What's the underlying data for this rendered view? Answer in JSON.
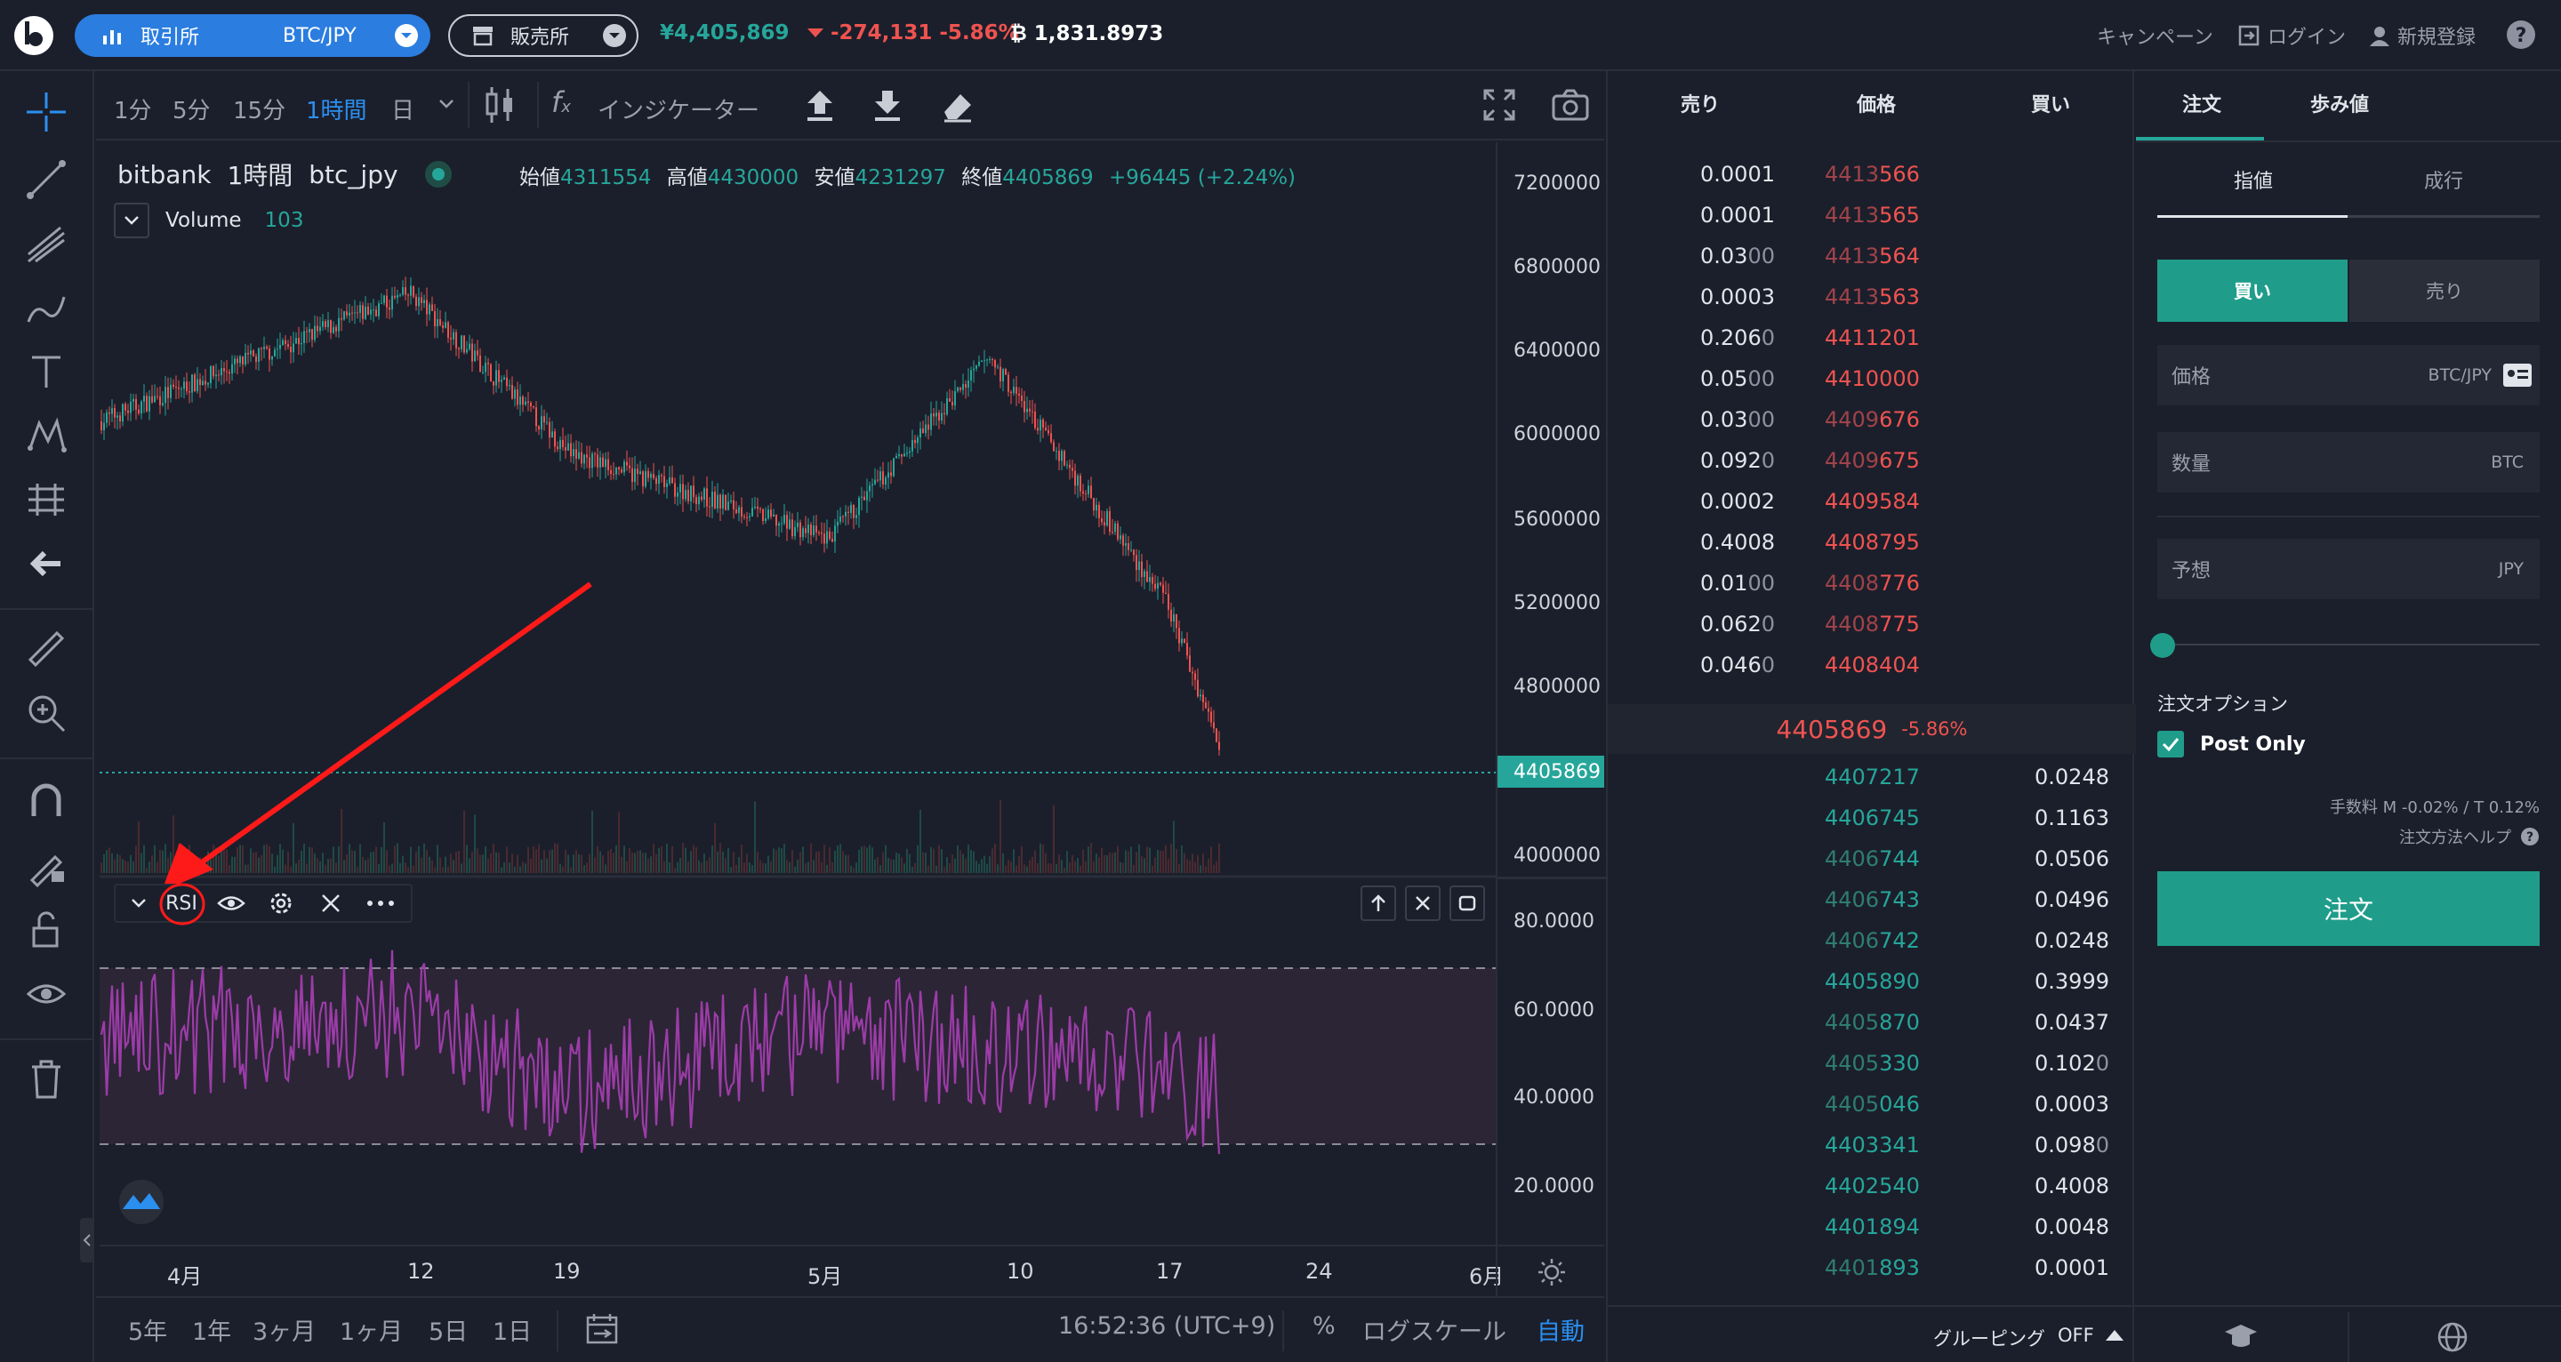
{
  "header": {
    "exchange_label": "取引所",
    "pair_label": "BTC/JPY",
    "store_label": "販売所",
    "price_jpy": "¥4,405,869",
    "change": "-274,131",
    "change_pct": "-5.86%",
    "btc_value": "1,831.8973",
    "campaign": "キャンペーン",
    "login": "ログイン",
    "signup": "新規登録"
  },
  "chart_toolbar": {
    "timeframes": [
      "1分",
      "5分",
      "15分",
      "1時間",
      "日"
    ],
    "active_timeframe": "1時間",
    "indicators": "インジケーター"
  },
  "legend": {
    "source": "bitbank",
    "interval": "1時間",
    "symbol": "btc_jpy",
    "open_label": "始値",
    "open": "4311554",
    "high_label": "高値",
    "high": "4430000",
    "low_label": "安値",
    "low": "4231297",
    "close_label": "終値",
    "close": "4405869",
    "change": "+96445 (+2.24%)",
    "volume_label": "Volume",
    "volume": "103"
  },
  "rsi_toolbar": {
    "label": "RSI"
  },
  "price_axis": {
    "labels": [
      "7200000",
      "6800000",
      "6400000",
      "6000000",
      "5600000",
      "5200000",
      "4800000",
      "4000000"
    ],
    "current": "4405869",
    "rsi_labels": [
      "80.0000",
      "60.0000",
      "40.0000",
      "20.0000"
    ]
  },
  "time_axis": {
    "labels": [
      "4月",
      "12",
      "19",
      "5月",
      "10",
      "17",
      "24",
      "6月"
    ]
  },
  "chart_bottom": {
    "ranges": [
      "5年",
      "1年",
      "3ヶ月",
      "1ヶ月",
      "5日",
      "1日"
    ],
    "clock": "16:52:36 (UTC+9)",
    "percent": "%",
    "log_scale": "ログスケール",
    "auto": "自動"
  },
  "chart_data": {
    "type": "line",
    "series": [
      {
        "x": [
          "4月",
          "12",
          "19",
          "5月",
          "10",
          "17",
          "24"
        ],
        "y": [
          6050000,
          6650000,
          5900000,
          5500000,
          6350000,
          5200000,
          4405869
        ]
      },
      {
        "x": [
          "4月",
          "12",
          "19",
          "5月",
          "10",
          "17",
          "24"
        ],
        "y": [
          55,
          62,
          40,
          58,
          52,
          45,
          38
        ]
      }
    ],
    "ylim": [
      4000000,
      7200000
    ],
    "rsi_ylim": [
      10,
      90
    ]
  },
  "orderbook": {
    "headers": {
      "sell": "売り",
      "price": "価格",
      "buy": "買い"
    },
    "asks": [
      {
        "qty": "0.0001",
        "qty_dim": "",
        "px_dim": "4413",
        "px": "566"
      },
      {
        "qty": "0.0001",
        "qty_dim": "",
        "px_dim": "4413",
        "px": "565"
      },
      {
        "qty": "0.03",
        "qty_dim": "00",
        "px_dim": "4413",
        "px": "564"
      },
      {
        "qty": "0.0003",
        "qty_dim": "",
        "px_dim": "4413",
        "px": "563"
      },
      {
        "qty": "0.206",
        "qty_dim": "0",
        "px_dim": "",
        "px": "4411201"
      },
      {
        "qty": "0.05",
        "qty_dim": "00",
        "px_dim": "",
        "px": "4410000"
      },
      {
        "qty": "0.03",
        "qty_dim": "00",
        "px_dim": "4409",
        "px": "676"
      },
      {
        "qty": "0.092",
        "qty_dim": "0",
        "px_dim": "4409",
        "px": "675"
      },
      {
        "qty": "0.0002",
        "qty_dim": "",
        "px_dim": "",
        "px": "4409584"
      },
      {
        "qty": "0.4008",
        "qty_dim": "",
        "px_dim": "",
        "px": "4408795"
      },
      {
        "qty": "0.01",
        "qty_dim": "00",
        "px_dim": "4408",
        "px": "776"
      },
      {
        "qty": "0.062",
        "qty_dim": "0",
        "px_dim": "4408",
        "px": "775"
      },
      {
        "qty": "0.046",
        "qty_dim": "0",
        "px_dim": "",
        "px": "4408404"
      }
    ],
    "mid_price": "4405869",
    "mid_change": "-5.86%",
    "bids": [
      {
        "px_dim": "",
        "px": "4407217",
        "qty": "0.0248",
        "qty_dim": ""
      },
      {
        "px_dim": "",
        "px": "4406745",
        "qty": "0.1163",
        "qty_dim": ""
      },
      {
        "px_dim": "4406",
        "px": "744",
        "qty": "0.0506",
        "qty_dim": ""
      },
      {
        "px_dim": "4406",
        "px": "743",
        "qty": "0.0496",
        "qty_dim": ""
      },
      {
        "px_dim": "4406",
        "px": "742",
        "qty": "0.0248",
        "qty_dim": ""
      },
      {
        "px_dim": "",
        "px": "4405890",
        "qty": "0.3999",
        "qty_dim": ""
      },
      {
        "px_dim": "4405",
        "px": "870",
        "qty": "0.0437",
        "qty_dim": ""
      },
      {
        "px_dim": "4405",
        "px": "330",
        "qty": "0.102",
        "qty_dim": "0"
      },
      {
        "px_dim": "4405",
        "px": "046",
        "qty": "0.0003",
        "qty_dim": ""
      },
      {
        "px_dim": "",
        "px": "4403341",
        "qty": "0.098",
        "qty_dim": "0"
      },
      {
        "px_dim": "",
        "px": "4402540",
        "qty": "0.4008",
        "qty_dim": ""
      },
      {
        "px_dim": "",
        "px": "4401894",
        "qty": "0.0048",
        "qty_dim": ""
      },
      {
        "px_dim": "4401",
        "px": "893",
        "qty": "0.0001",
        "qty_dim": ""
      }
    ],
    "grouping_label": "グルーピング",
    "grouping_value": "OFF"
  },
  "order_panel": {
    "tabs": [
      "注文",
      "歩み値"
    ],
    "order_types": [
      "指値",
      "成行"
    ],
    "sides": [
      "買い",
      "売り"
    ],
    "price_label": "価格",
    "price_unit": "BTC/JPY",
    "amount_label": "数量",
    "amount_unit": "BTC",
    "estimate_label": "予想",
    "estimate_unit": "JPY",
    "options_label": "注文オプション",
    "post_only": "Post Only",
    "fee": "手数料 M -0.02% / T 0.12%",
    "help": "注文方法ヘルプ",
    "submit": "注文"
  },
  "colors": {
    "accent": "#2b8ff0",
    "up": "#26a69a",
    "down": "#ef5350",
    "rsi": "#9c3ca8"
  }
}
